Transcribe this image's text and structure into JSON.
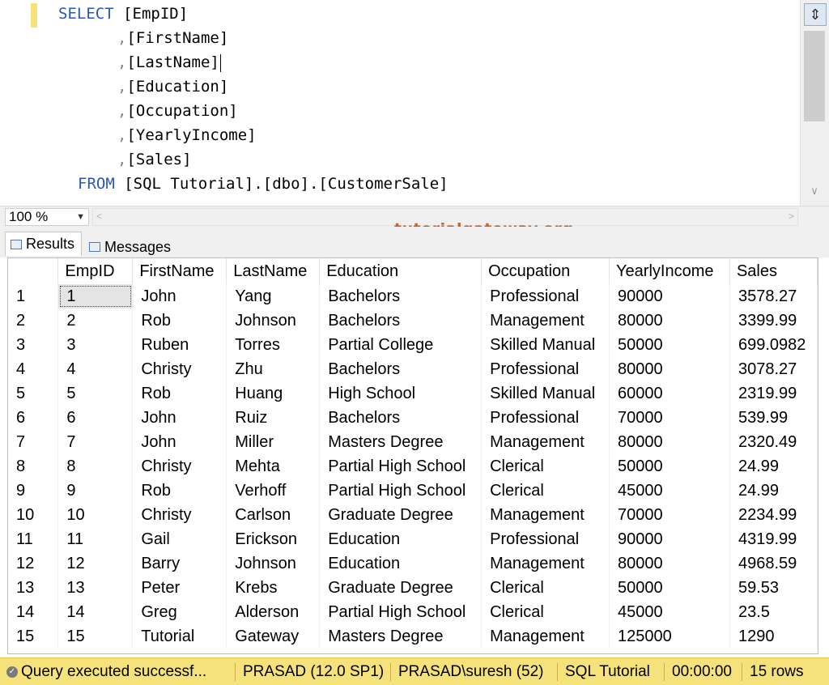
{
  "editor": {
    "lines": [
      {
        "kw": "SELECT",
        "comma": "",
        "text": "[EmpID]"
      },
      {
        "kw": "",
        "comma": ",",
        "text": "[FirstName]"
      },
      {
        "kw": "",
        "comma": ",",
        "text": "[LastName]"
      },
      {
        "kw": "",
        "comma": ",",
        "text": "[Education]"
      },
      {
        "kw": "",
        "comma": ",",
        "text": "[Occupation]"
      },
      {
        "kw": "",
        "comma": ",",
        "text": "[YearlyIncome]"
      },
      {
        "kw": "",
        "comma": ",",
        "text": "[Sales]"
      },
      {
        "kw": "FROM",
        "comma": "",
        "text": "[SQL Tutorial].[dbo].[CustomerSale]"
      }
    ]
  },
  "zoom": {
    "value": "100 %"
  },
  "watermark": "tutorialgateway.org",
  "tabs": {
    "results": "Results",
    "messages": "Messages"
  },
  "grid": {
    "columns": [
      "EmpID",
      "FirstName",
      "LastName",
      "Education",
      "Occupation",
      "YearlyIncome",
      "Sales"
    ],
    "rows": [
      [
        "1",
        "1",
        "John",
        "Yang",
        "Bachelors",
        "Professional",
        "90000",
        "3578.27"
      ],
      [
        "2",
        "2",
        "Rob",
        "Johnson",
        "Bachelors",
        "Management",
        "80000",
        "3399.99"
      ],
      [
        "3",
        "3",
        "Ruben",
        "Torres",
        "Partial College",
        "Skilled Manual",
        "50000",
        "699.0982"
      ],
      [
        "4",
        "4",
        "Christy",
        "Zhu",
        "Bachelors",
        "Professional",
        "80000",
        "3078.27"
      ],
      [
        "5",
        "5",
        "Rob",
        "Huang",
        "High School",
        "Skilled Manual",
        "60000",
        "2319.99"
      ],
      [
        "6",
        "6",
        "John",
        "Ruiz",
        "Bachelors",
        "Professional",
        "70000",
        "539.99"
      ],
      [
        "7",
        "7",
        "John",
        "Miller",
        "Masters Degree",
        "Management",
        "80000",
        "2320.49"
      ],
      [
        "8",
        "8",
        "Christy",
        "Mehta",
        "Partial High School",
        "Clerical",
        "50000",
        "24.99"
      ],
      [
        "9",
        "9",
        "Rob",
        "Verhoff",
        "Partial High School",
        "Clerical",
        "45000",
        "24.99"
      ],
      [
        "10",
        "10",
        "Christy",
        "Carlson",
        "Graduate Degree",
        "Management",
        "70000",
        "2234.99"
      ],
      [
        "11",
        "11",
        "Gail",
        "Erickson",
        "Education",
        "Professional",
        "90000",
        "4319.99"
      ],
      [
        "12",
        "12",
        "Barry",
        "Johnson",
        "Education",
        "Management",
        "80000",
        "4968.59"
      ],
      [
        "13",
        "13",
        "Peter",
        "Krebs",
        "Graduate Degree",
        "Clerical",
        "50000",
        "59.53"
      ],
      [
        "14",
        "14",
        "Greg",
        "Alderson",
        "Partial High School",
        "Clerical",
        "45000",
        "23.5"
      ],
      [
        "15",
        "15",
        "Tutorial",
        "Gateway",
        "Masters Degree",
        "Management",
        "125000",
        "1290"
      ]
    ]
  },
  "status": {
    "message": "Query executed successf...",
    "server": "PRASAD (12.0 SP1)",
    "user": "PRASAD\\suresh (52)",
    "database": "SQL Tutorial",
    "elapsed": "00:00:00",
    "rows": "15 rows"
  },
  "colors": {
    "keyword": "#2a57b8",
    "statusbar": "#f5e27a",
    "watermark": "#c8622a"
  }
}
